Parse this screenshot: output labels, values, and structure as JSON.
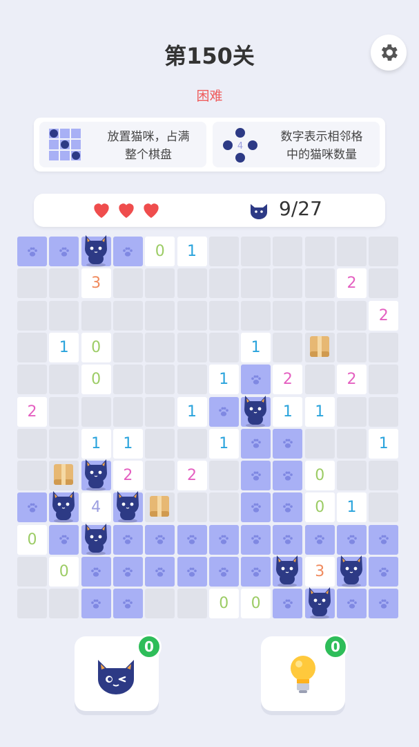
{
  "header": {
    "title": "第150关",
    "difficulty": "困难"
  },
  "colors": {
    "accent": "#a8b0f5",
    "difficulty": "#ef5b5b",
    "heart": "#ef4d4d",
    "cat": "#2d3a85",
    "badge": "#2ebd59"
  },
  "rules": [
    {
      "text": "放置猫咪，占满\n整个棋盘",
      "icon": "mini-board-icon"
    },
    {
      "text": "数字表示相邻格\n中的猫咪数量",
      "icon": "mini-number-grid-icon",
      "icon_number": "4"
    }
  ],
  "status": {
    "lives": 3,
    "cat_count": "9/27"
  },
  "board": {
    "rows": [
      [
        "p",
        "p",
        "p",
        "p",
        "0",
        "1",
        "u",
        "u",
        "u",
        "u",
        "u",
        "u"
      ],
      [
        "u",
        "u",
        "3",
        "u",
        "u",
        "u",
        "u",
        "u",
        "u",
        "u",
        "2",
        "u"
      ],
      [
        "u",
        "u",
        "u",
        "u",
        "u",
        "u",
        "u",
        "u",
        "u",
        "u",
        "u",
        "2"
      ],
      [
        "u",
        "1",
        "0",
        "u",
        "u",
        "u",
        "u",
        "1",
        "u",
        "u",
        "u",
        "u"
      ],
      [
        "u",
        "u",
        "0",
        "u",
        "u",
        "u",
        "1",
        "p",
        "2",
        "u",
        "2",
        "u"
      ],
      [
        "2",
        "u",
        "u",
        "u",
        "u",
        "1",
        "p",
        "p",
        "1",
        "1",
        "u",
        "u"
      ],
      [
        "u",
        "u",
        "1",
        "1",
        "u",
        "u",
        "1",
        "p",
        "p",
        "u",
        "u",
        "1"
      ],
      [
        "u",
        "u",
        "p",
        "2",
        "u",
        "2",
        "u",
        "p",
        "p",
        "0",
        "u",
        "u"
      ],
      [
        "p",
        "p",
        "4",
        "p",
        "u",
        "u",
        "u",
        "p",
        "p",
        "0",
        "1",
        "u"
      ],
      [
        "0",
        "p",
        "p",
        "p",
        "p",
        "p",
        "p",
        "p",
        "p",
        "p",
        "p",
        "p"
      ],
      [
        "u",
        "0",
        "p",
        "p",
        "p",
        "p",
        "p",
        "p",
        "p",
        "3",
        "p",
        "p"
      ],
      [
        "u",
        "u",
        "p",
        "p",
        "u",
        "u",
        "0",
        "0",
        "p",
        "p",
        "p",
        "p"
      ]
    ],
    "cats": [
      [
        0,
        2
      ],
      [
        5,
        7
      ],
      [
        7,
        2
      ],
      [
        8,
        1
      ],
      [
        8,
        3
      ],
      [
        9,
        2
      ],
      [
        10,
        8
      ],
      [
        10,
        10
      ],
      [
        11,
        9
      ]
    ],
    "boxes": [
      [
        3,
        9
      ],
      [
        7,
        1
      ],
      [
        8,
        4
      ]
    ],
    "number_colors": {
      "0": "#9ccc65",
      "1": "#29a3dc",
      "2": "#e45fc0",
      "3": "#f08a5d",
      "4": "#9b9ee0"
    }
  },
  "tools": [
    {
      "name": "cat-hint",
      "count": "0",
      "icon": "winking-cat-icon"
    },
    {
      "name": "bulb-hint",
      "count": "0",
      "icon": "lightbulb-icon"
    }
  ]
}
